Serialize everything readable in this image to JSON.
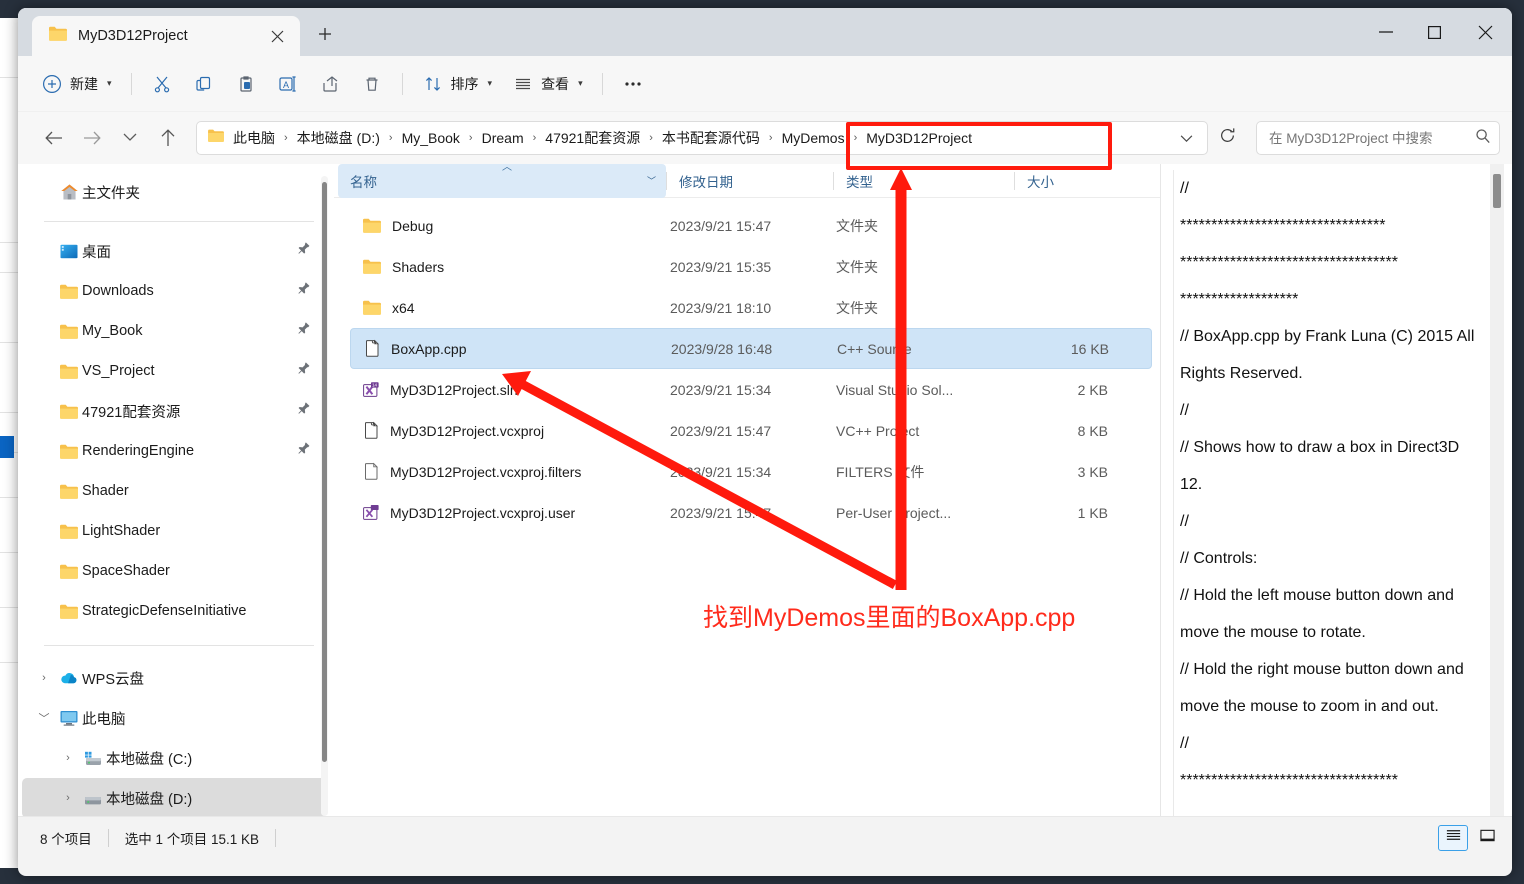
{
  "window": {
    "tab_label": "MyD3D12Project",
    "tab_close_icon": "close-icon",
    "new_tab_icon": "plus-icon",
    "minimize_icon": "minimize-icon",
    "maximize_icon": "maximize-icon",
    "close_icon": "close-icon"
  },
  "toolbar": {
    "new_label": "新建",
    "new_icon": "plus-circle-icon",
    "cut_icon": "scissors-icon",
    "copy_icon": "copy-icon",
    "paste_icon": "clipboard-icon",
    "rename_icon": "rename-icon",
    "share_icon": "share-icon",
    "delete_icon": "trash-icon",
    "sort_label": "排序",
    "sort_icon": "sort-arrows-icon",
    "view_label": "查看",
    "view_icon": "list-lines-icon",
    "more_label": "···",
    "more_icon": "ellipsis-icon"
  },
  "navigation": {
    "back_icon": "arrow-left-icon",
    "forward_icon": "arrow-right-icon",
    "recent_icon": "chevron-down-icon",
    "up_icon": "arrow-up-icon",
    "address_folder_icon": "folder-icon",
    "address_dropdown_icon": "chevron-down-icon",
    "refresh_icon": "refresh-icon",
    "breadcrumbs": [
      "此电脑",
      "本地磁盘 (D:)",
      "My_Book",
      "Dream",
      "47921配套资源",
      "本书配套源代码",
      "MyDemos",
      "MyD3D12Project"
    ],
    "breadcrumb_separator": "›"
  },
  "search": {
    "placeholder": "在 MyD3D12Project 中搜索",
    "value": "",
    "icon": "search-icon"
  },
  "sidebar": {
    "home": {
      "label": "主文件夹",
      "icon": "home-icon"
    },
    "quick_access": [
      {
        "label": "桌面",
        "icon": "desktop-icon",
        "pinned": true
      },
      {
        "label": "Downloads",
        "icon": "folder-icon",
        "pinned": true
      },
      {
        "label": "My_Book",
        "icon": "folder-icon",
        "pinned": true
      },
      {
        "label": "VS_Project",
        "icon": "folder-icon",
        "pinned": true
      },
      {
        "label": "47921配套资源",
        "icon": "folder-icon",
        "pinned": true
      },
      {
        "label": "RenderingEngine",
        "icon": "folder-icon",
        "pinned": true
      },
      {
        "label": "Shader",
        "icon": "folder-icon",
        "pinned": false
      },
      {
        "label": "LightShader",
        "icon": "folder-icon",
        "pinned": false
      },
      {
        "label": "SpaceShader",
        "icon": "folder-icon",
        "pinned": false
      },
      {
        "label": "StrategicDefenseInitiative",
        "icon": "folder-icon",
        "pinned": false
      }
    ],
    "tree": [
      {
        "label": "WPS云盘",
        "icon": "cloud-icon",
        "expanded": false,
        "selected": false
      },
      {
        "label": "此电脑",
        "icon": "monitor-icon",
        "expanded": true,
        "selected": false
      },
      {
        "label": "本地磁盘 (C:)",
        "icon": "windows-drive-icon",
        "expanded": false,
        "selected": false,
        "indent": true
      },
      {
        "label": "本地磁盘 (D:)",
        "icon": "drive-icon",
        "expanded": false,
        "selected": true,
        "indent": true
      }
    ],
    "pin_icon": "pin-icon"
  },
  "filelist": {
    "columns": [
      {
        "key": "name",
        "label": "名称",
        "sorted": true,
        "sort_dir": "asc"
      },
      {
        "key": "date",
        "label": "修改日期",
        "sorted": false
      },
      {
        "key": "type",
        "label": "类型",
        "sorted": false
      },
      {
        "key": "size",
        "label": "大小",
        "sorted": false
      }
    ],
    "rows": [
      {
        "name": "Debug",
        "date": "2023/9/21 15:47",
        "type": "文件夹",
        "size": "",
        "icon": "folder-icon",
        "selected": false
      },
      {
        "name": "Shaders",
        "date": "2023/9/21 15:35",
        "type": "文件夹",
        "size": "",
        "icon": "folder-icon",
        "selected": false
      },
      {
        "name": "x64",
        "date": "2023/9/21 18:10",
        "type": "文件夹",
        "size": "",
        "icon": "folder-icon",
        "selected": false
      },
      {
        "name": "BoxApp.cpp",
        "date": "2023/9/28 16:48",
        "type": "C++ Source",
        "size": "16 KB",
        "icon": "cpp-file-icon",
        "selected": true
      },
      {
        "name": "MyD3D12Project.sln",
        "date": "2023/9/21 15:34",
        "type": "Visual Studio Sol...",
        "size": "2 KB",
        "icon": "sln-file-icon",
        "selected": false
      },
      {
        "name": "MyD3D12Project.vcxproj",
        "date": "2023/9/21 15:47",
        "type": "VC++ Project",
        "size": "8 KB",
        "icon": "vcxproj-file-icon",
        "selected": false
      },
      {
        "name": "MyD3D12Project.vcxproj.filters",
        "date": "2023/9/21 15:34",
        "type": "FILTERS 文件",
        "size": "3 KB",
        "icon": "generic-file-icon",
        "selected": false
      },
      {
        "name": "MyD3D12Project.vcxproj.user",
        "date": "2023/9/21 15:47",
        "type": "Per-User Project...",
        "size": "1 KB",
        "icon": "user-file-icon",
        "selected": false
      }
    ]
  },
  "preview": {
    "lines": [
      "//",
      "*********************************",
      "***********************************",
      "*******************",
      "// BoxApp.cpp by Frank Luna (C) 2015 All Rights Reserved.",
      "//",
      "// Shows how to draw a box in Direct3D 12.",
      "//",
      "// Controls:",
      "//   Hold the left mouse button down and move the mouse to rotate.",
      "//   Hold the right mouse button down and move the mouse to zoom in and out.",
      "//",
      "***********************************"
    ]
  },
  "statusbar": {
    "item_count": "8 个项目",
    "selection": "选中 1 个项目  15.1 KB",
    "details_view_icon": "details-view-icon",
    "preview_pane_icon": "preview-pane-icon"
  },
  "annotations": {
    "callout_text": "找到MyDemos里面的BoxApp.cpp",
    "highlight_color": "#ff1a0d",
    "text_color": "#ff2b1c",
    "box_target": "MyDemos › MyD3D12Project",
    "arrow_up_target": "MyDemos breadcrumb",
    "arrow_left_target": "BoxApp.cpp row"
  }
}
